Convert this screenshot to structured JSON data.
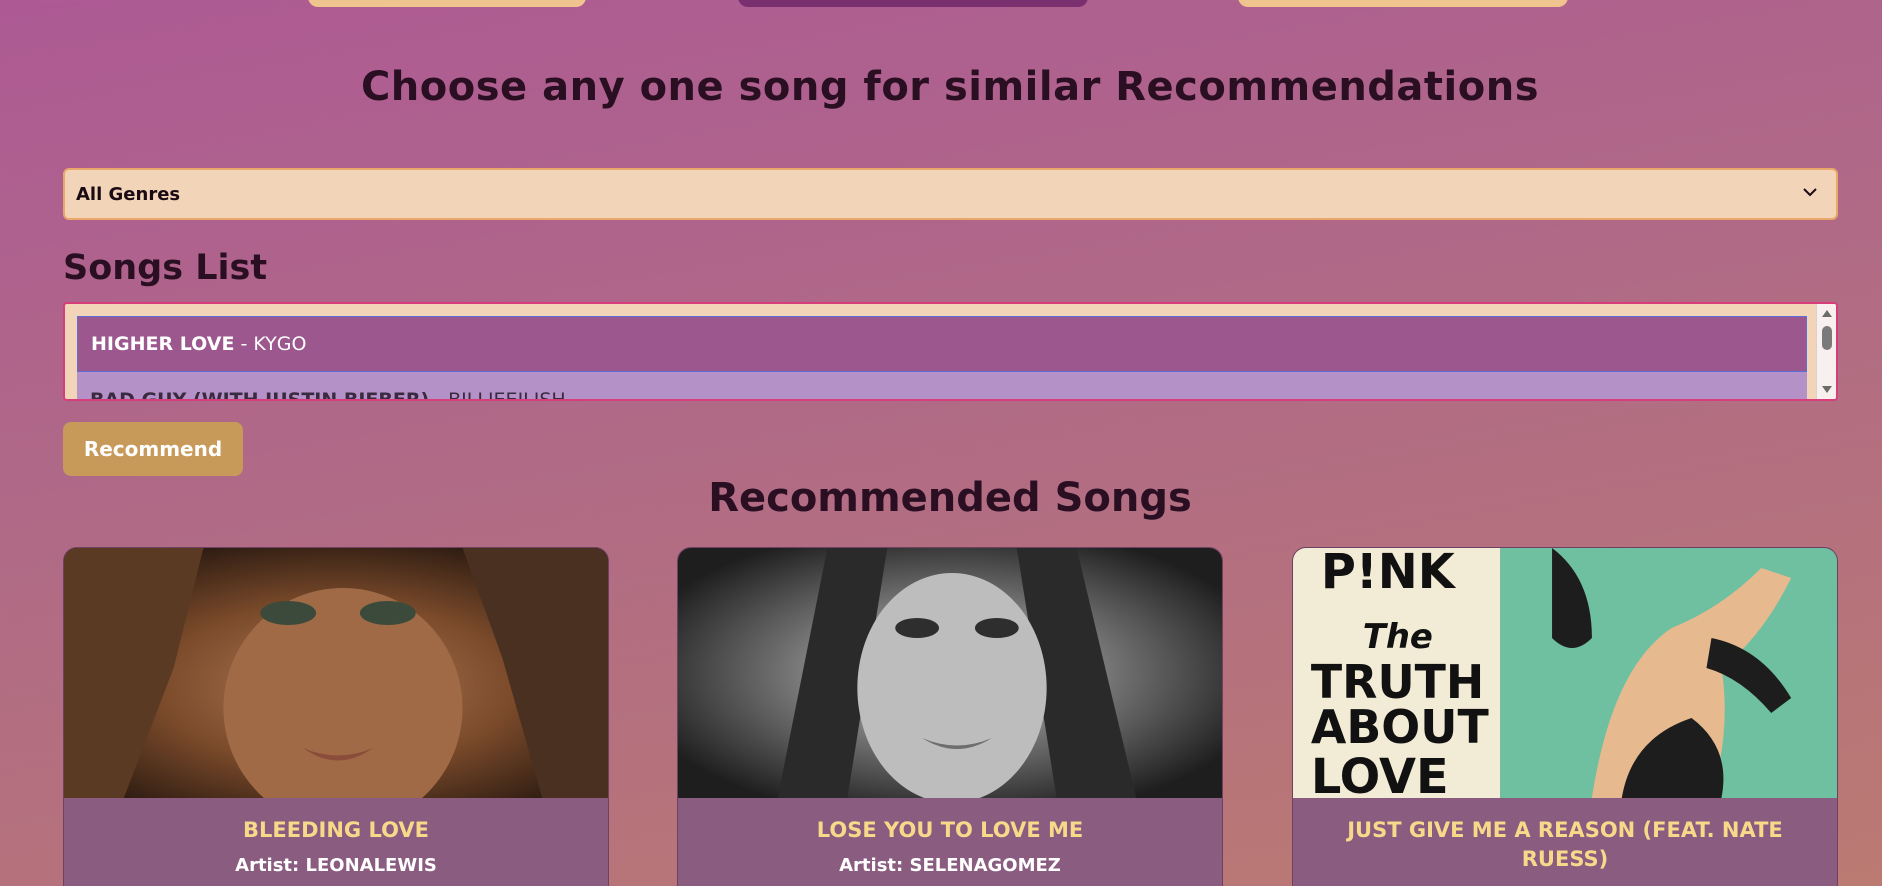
{
  "page": {
    "heading": "Choose any one song for similar Recommendations",
    "songs_list_heading": "Songs List",
    "recommended_heading": "Recommended Songs"
  },
  "genre_select": {
    "value": "All Genres",
    "icon": "chevron-down-icon"
  },
  "songs_list": [
    {
      "title": "HIGHER LOVE",
      "separator": " - ",
      "artist": "KYGO",
      "selected": true
    },
    {
      "title": "BAD GUY (WITH JUSTIN BIEBER)",
      "separator": " - ",
      "artist": "BILLIEEILISH",
      "selected": false
    }
  ],
  "recommend_button": {
    "label": "Recommend"
  },
  "recommendations": [
    {
      "title": "BLEEDING LOVE",
      "artist": "Artist: LEONALEWIS"
    },
    {
      "title": "LOSE YOU TO LOVE ME",
      "artist": "Artist: SELENAGOMEZ"
    },
    {
      "title": "JUST GIVE ME A REASON (FEAT. NATE RUESS)",
      "artist": "",
      "cover_text": [
        "P!NK",
        "The",
        "TRUTH",
        "ABOUT",
        "LOVE"
      ]
    }
  ],
  "colors": {
    "accent": "#c79a5a",
    "select_bg": "#f2d5b8",
    "selected_row": "#9c578e",
    "card_title": "#f8d98a"
  }
}
